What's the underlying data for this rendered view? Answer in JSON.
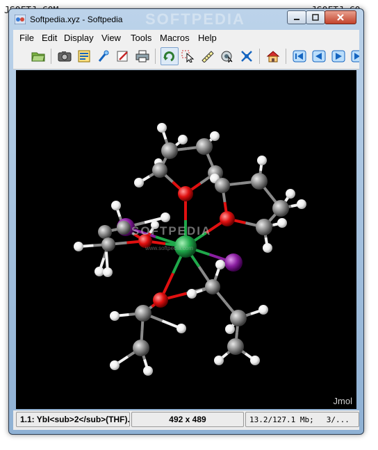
{
  "watermarks": {
    "top_left": "JSOFTJ.COM",
    "top_right": "JSOFTJ.CO",
    "banner": "SOFTPEDIA",
    "viewer_main": "SOFTPEDIA",
    "viewer_sub": "www.softpedia.com"
  },
  "window": {
    "title": "Softpedia.xyz - Softpedia"
  },
  "menu": {
    "items": [
      "File",
      "Edit",
      "Display",
      "View",
      "Tools",
      "Macros",
      "Help"
    ]
  },
  "toolbar": {
    "buttons": [
      {
        "icon": "open-folder-icon"
      },
      {
        "icon": "camera-icon"
      },
      {
        "icon": "script-icon"
      },
      {
        "icon": "pick-wand-icon"
      },
      {
        "icon": "edit-script-icon"
      },
      {
        "icon": "print-icon"
      },
      {
        "icon": "rotate-icon",
        "selected": true
      },
      {
        "icon": "select-pointer-icon"
      },
      {
        "icon": "measure-ruler-icon"
      },
      {
        "icon": "spin-icon"
      },
      {
        "icon": "atom-move-icon"
      },
      {
        "icon": "home-icon"
      },
      {
        "icon": "first-frame-icon"
      },
      {
        "icon": "previous-frame-icon"
      },
      {
        "icon": "next-frame-icon"
      },
      {
        "icon": "last-frame-icon"
      }
    ]
  },
  "viewer": {
    "label": "Jmol",
    "background": "#000000"
  },
  "status": {
    "molecule": "1.1: YbI<sub>2</sub>(THF)...",
    "size": "492 x 489",
    "memory": "13.2/127.1 Mb;",
    "frames": "3/..."
  },
  "colors": {
    "oxygen": "#e01010",
    "carbon": "#8a8a8a",
    "hydrogen": "#f2f2f2",
    "ytterbium": "#1fa84a",
    "iodine": "#8a1fa0"
  }
}
